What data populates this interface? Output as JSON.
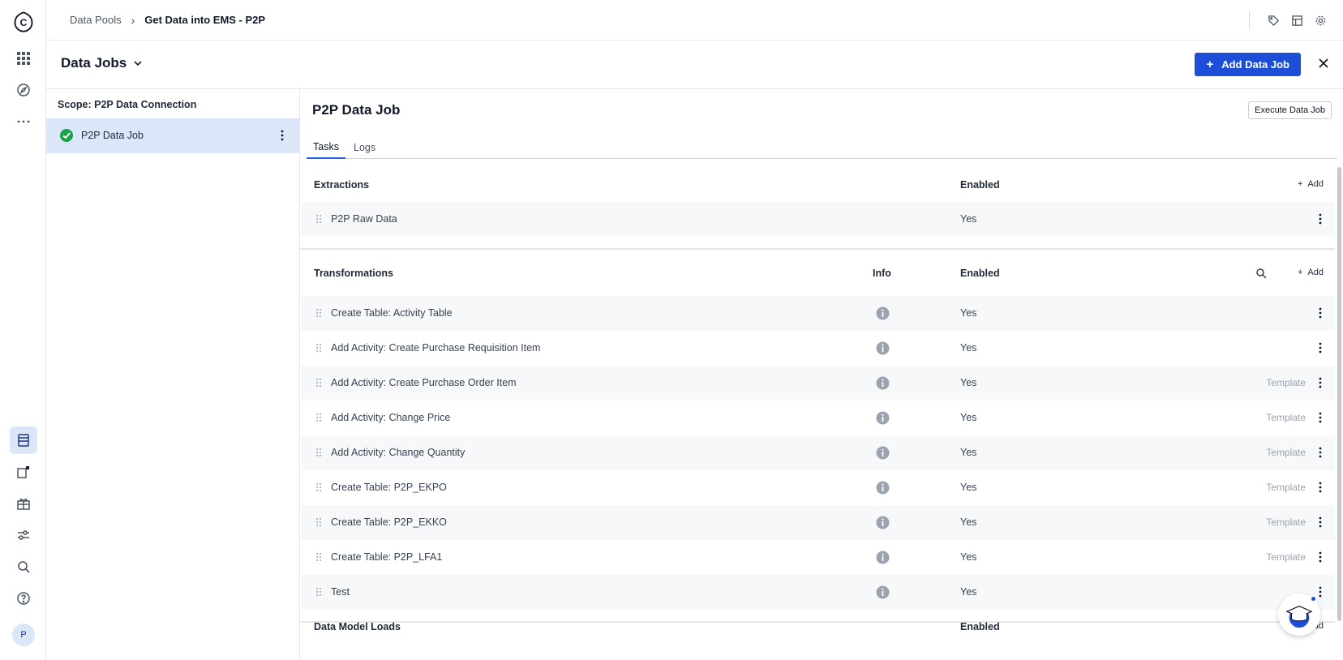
{
  "rail": {
    "logo_letter": "C",
    "avatar_letter": "P"
  },
  "breadcrumb": {
    "first": "Data Pools",
    "second": "Get Data into EMS - P2P"
  },
  "subbar": {
    "title": "Data Jobs",
    "add_button": "Add Data Job"
  },
  "left": {
    "scope": "Scope: P2P Data Connection",
    "job": "P2P Data Job"
  },
  "main": {
    "title": "P2P Data Job",
    "execute_button": "Execute Data Job",
    "tabs": [
      "Tasks",
      "Logs"
    ]
  },
  "extractions": {
    "title": "Extractions",
    "enabled_col": "Enabled",
    "add": "Add",
    "rows": [
      {
        "label": "P2P Raw Data",
        "enabled": "Yes"
      }
    ]
  },
  "transformations": {
    "title": "Transformations",
    "info_col": "Info",
    "enabled_col": "Enabled",
    "add": "Add",
    "rows": [
      {
        "label": "Create Table: Activity Table",
        "enabled": "Yes",
        "template": ""
      },
      {
        "label": "Add Activity: Create Purchase Requisition Item",
        "enabled": "Yes",
        "template": ""
      },
      {
        "label": "Add Activity: Create Purchase Order Item",
        "enabled": "Yes",
        "template": "Template"
      },
      {
        "label": "Add Activity: Change Price",
        "enabled": "Yes",
        "template": "Template"
      },
      {
        "label": "Add Activity: Change Quantity",
        "enabled": "Yes",
        "template": "Template"
      },
      {
        "label": "Create Table: P2P_EKPO",
        "enabled": "Yes",
        "template": "Template"
      },
      {
        "label": "Create Table: P2P_EKKO",
        "enabled": "Yes",
        "template": "Template"
      },
      {
        "label": "Create Table: P2P_LFA1",
        "enabled": "Yes",
        "template": "Template"
      },
      {
        "label": "Test",
        "enabled": "Yes",
        "template": ""
      }
    ]
  },
  "model_loads": {
    "title": "Data Model Loads",
    "enabled_col": "Enabled",
    "add": "Add"
  },
  "colors": {
    "primary": "#1d4ed8",
    "selected_row": "#dbe7f9",
    "success": "#16a34a"
  }
}
